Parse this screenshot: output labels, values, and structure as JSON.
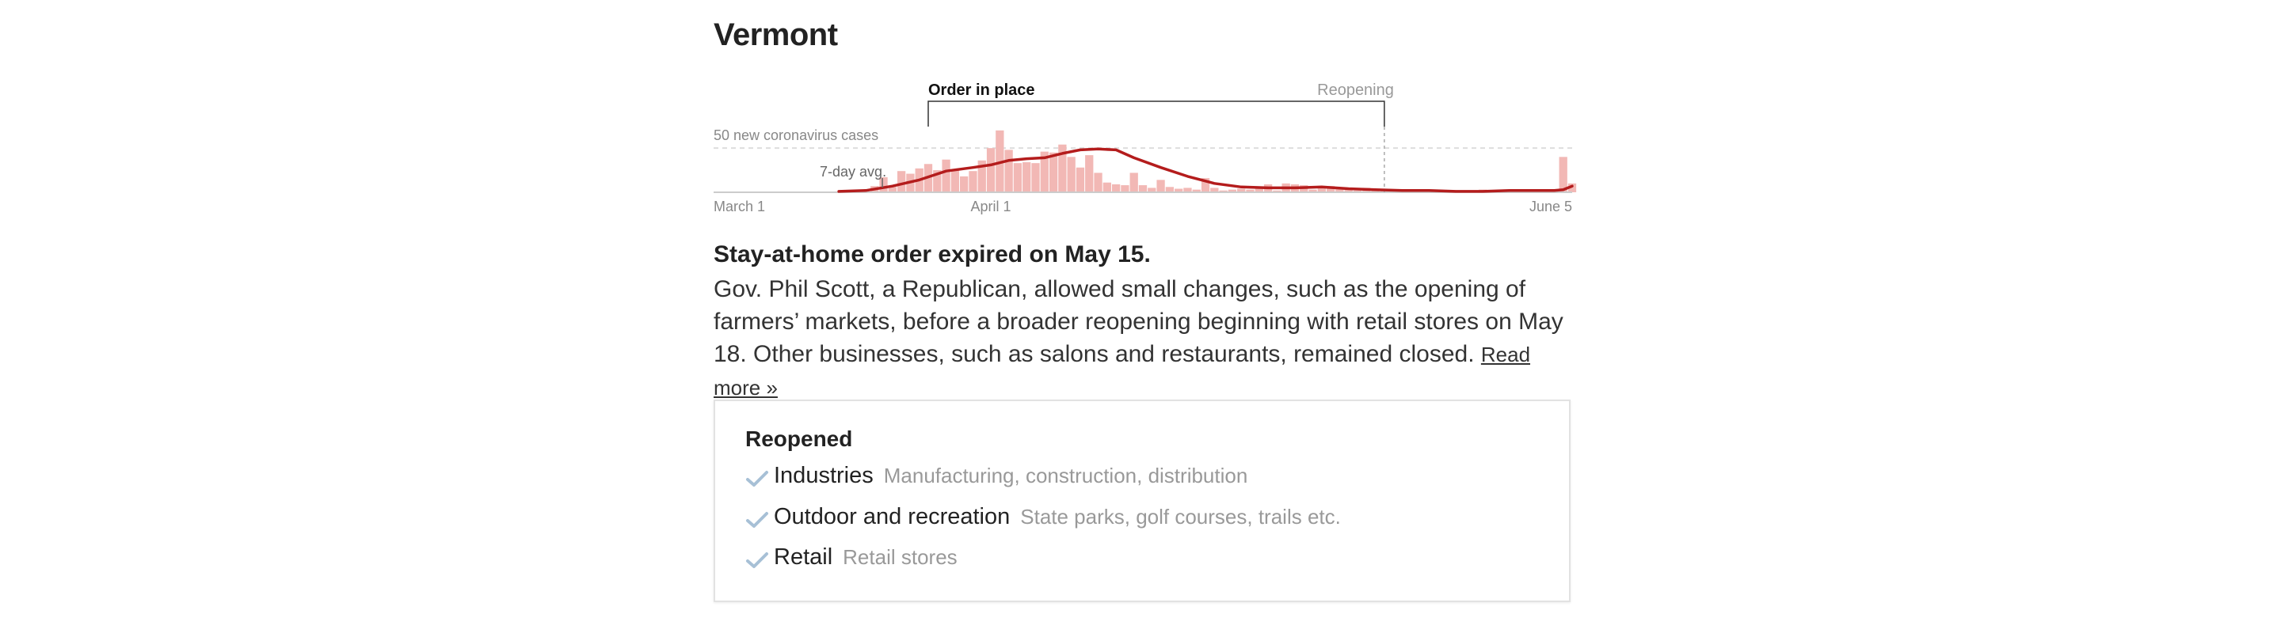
{
  "state": "Vermont",
  "chart_data": {
    "type": "bar",
    "title": "",
    "y_reference": {
      "value": 50,
      "label": "50 new coronavirus cases"
    },
    "ylim": [
      0,
      60
    ],
    "avg_label": "7-day avg.",
    "x_tick_labels": [
      "March 1",
      "April 1",
      "June 5"
    ],
    "x_start": "2020-03-01",
    "x_end": "2020-06-05",
    "periods": [
      {
        "label": "Order in place",
        "start": "2020-03-25",
        "end": "2020-05-15"
      },
      {
        "label": "Reopening",
        "start": "2020-05-15",
        "end": "2020-06-05"
      }
    ],
    "bars": [
      {
        "date": "2020-03-15",
        "cases": 1
      },
      {
        "date": "2020-03-16",
        "cases": 2
      },
      {
        "date": "2020-03-17",
        "cases": 3
      },
      {
        "date": "2020-03-18",
        "cases": 2
      },
      {
        "date": "2020-03-19",
        "cases": 7
      },
      {
        "date": "2020-03-20",
        "cases": 17
      },
      {
        "date": "2020-03-21",
        "cases": 6
      },
      {
        "date": "2020-03-22",
        "cases": 24
      },
      {
        "date": "2020-03-23",
        "cases": 21
      },
      {
        "date": "2020-03-24",
        "cases": 27
      },
      {
        "date": "2020-03-25",
        "cases": 32
      },
      {
        "date": "2020-03-26",
        "cases": 25
      },
      {
        "date": "2020-03-27",
        "cases": 37
      },
      {
        "date": "2020-03-28",
        "cases": 25
      },
      {
        "date": "2020-03-29",
        "cases": 18
      },
      {
        "date": "2020-03-30",
        "cases": 24
      },
      {
        "date": "2020-03-31",
        "cases": 36
      },
      {
        "date": "2020-04-01",
        "cases": 50
      },
      {
        "date": "2020-04-02",
        "cases": 70
      },
      {
        "date": "2020-04-03",
        "cases": 48
      },
      {
        "date": "2020-04-04",
        "cases": 33
      },
      {
        "date": "2020-04-05",
        "cases": 34
      },
      {
        "date": "2020-04-06",
        "cases": 33
      },
      {
        "date": "2020-04-07",
        "cases": 46
      },
      {
        "date": "2020-04-08",
        "cases": 45
      },
      {
        "date": "2020-04-09",
        "cases": 54
      },
      {
        "date": "2020-04-10",
        "cases": 40
      },
      {
        "date": "2020-04-11",
        "cases": 28
      },
      {
        "date": "2020-04-12",
        "cases": 42
      },
      {
        "date": "2020-04-13",
        "cases": 22
      },
      {
        "date": "2020-04-14",
        "cases": 11
      },
      {
        "date": "2020-04-15",
        "cases": 9
      },
      {
        "date": "2020-04-16",
        "cases": 8
      },
      {
        "date": "2020-04-17",
        "cases": 22
      },
      {
        "date": "2020-04-18",
        "cases": 8
      },
      {
        "date": "2020-04-19",
        "cases": 5
      },
      {
        "date": "2020-04-20",
        "cases": 14
      },
      {
        "date": "2020-04-21",
        "cases": 6
      },
      {
        "date": "2020-04-22",
        "cases": 4
      },
      {
        "date": "2020-04-23",
        "cases": 5
      },
      {
        "date": "2020-04-24",
        "cases": 3
      },
      {
        "date": "2020-04-25",
        "cases": 16
      },
      {
        "date": "2020-04-26",
        "cases": 5
      },
      {
        "date": "2020-04-27",
        "cases": 2
      },
      {
        "date": "2020-04-28",
        "cases": 3
      },
      {
        "date": "2020-04-29",
        "cases": 4
      },
      {
        "date": "2020-04-30",
        "cases": 3
      },
      {
        "date": "2020-05-01",
        "cases": 5
      },
      {
        "date": "2020-05-02",
        "cases": 9
      },
      {
        "date": "2020-05-03",
        "cases": 2
      },
      {
        "date": "2020-05-04",
        "cases": 10
      },
      {
        "date": "2020-05-05",
        "cases": 9
      },
      {
        "date": "2020-05-06",
        "cases": 8
      },
      {
        "date": "2020-05-07",
        "cases": 3
      },
      {
        "date": "2020-05-08",
        "cases": 5
      },
      {
        "date": "2020-05-09",
        "cases": 7
      },
      {
        "date": "2020-05-10",
        "cases": 4
      },
      {
        "date": "2020-05-11",
        "cases": 3
      },
      {
        "date": "2020-05-12",
        "cases": 2
      },
      {
        "date": "2020-05-13",
        "cases": 5
      },
      {
        "date": "2020-05-14",
        "cases": 3
      },
      {
        "date": "2020-05-15",
        "cases": 2
      },
      {
        "date": "2020-05-16",
        "cases": 1
      },
      {
        "date": "2020-05-17",
        "cases": 2
      },
      {
        "date": "2020-05-18",
        "cases": 3
      },
      {
        "date": "2020-05-19",
        "cases": 2
      },
      {
        "date": "2020-05-20",
        "cases": 1
      },
      {
        "date": "2020-05-21",
        "cases": 2
      },
      {
        "date": "2020-05-22",
        "cases": 1
      },
      {
        "date": "2020-05-23",
        "cases": 1
      },
      {
        "date": "2020-05-24",
        "cases": 2
      },
      {
        "date": "2020-05-25",
        "cases": 1
      },
      {
        "date": "2020-05-26",
        "cases": 3
      },
      {
        "date": "2020-05-27",
        "cases": 2
      },
      {
        "date": "2020-05-28",
        "cases": 3
      },
      {
        "date": "2020-05-29",
        "cases": 2
      },
      {
        "date": "2020-05-30",
        "cases": 3
      },
      {
        "date": "2020-05-31",
        "cases": 2
      },
      {
        "date": "2020-06-01",
        "cases": 1
      },
      {
        "date": "2020-06-02",
        "cases": 2
      },
      {
        "date": "2020-06-03",
        "cases": 3
      },
      {
        "date": "2020-06-04",
        "cases": 40
      },
      {
        "date": "2020-06-05",
        "cases": 10
      }
    ],
    "average": [
      {
        "date": "2020-03-15",
        "cases": 1
      },
      {
        "date": "2020-03-18",
        "cases": 2
      },
      {
        "date": "2020-03-21",
        "cases": 7
      },
      {
        "date": "2020-03-24",
        "cases": 14
      },
      {
        "date": "2020-03-27",
        "cases": 24
      },
      {
        "date": "2020-03-30",
        "cases": 28
      },
      {
        "date": "2020-04-01",
        "cases": 31
      },
      {
        "date": "2020-04-03",
        "cases": 36
      },
      {
        "date": "2020-04-05",
        "cases": 38
      },
      {
        "date": "2020-04-07",
        "cases": 39
      },
      {
        "date": "2020-04-09",
        "cases": 44
      },
      {
        "date": "2020-04-11",
        "cases": 48
      },
      {
        "date": "2020-04-13",
        "cases": 49
      },
      {
        "date": "2020-04-15",
        "cases": 48
      },
      {
        "date": "2020-04-17",
        "cases": 39
      },
      {
        "date": "2020-04-20",
        "cases": 28
      },
      {
        "date": "2020-04-23",
        "cases": 18
      },
      {
        "date": "2020-04-26",
        "cases": 10
      },
      {
        "date": "2020-04-29",
        "cases": 6
      },
      {
        "date": "2020-05-02",
        "cases": 5
      },
      {
        "date": "2020-05-05",
        "cases": 5
      },
      {
        "date": "2020-05-08",
        "cases": 6
      },
      {
        "date": "2020-05-11",
        "cases": 4
      },
      {
        "date": "2020-05-14",
        "cases": 3
      },
      {
        "date": "2020-05-17",
        "cases": 2
      },
      {
        "date": "2020-05-20",
        "cases": 2
      },
      {
        "date": "2020-05-23",
        "cases": 1
      },
      {
        "date": "2020-05-26",
        "cases": 1
      },
      {
        "date": "2020-05-29",
        "cases": 2
      },
      {
        "date": "2020-06-01",
        "cases": 2
      },
      {
        "date": "2020-06-03",
        "cases": 2
      },
      {
        "date": "2020-06-04",
        "cases": 3
      },
      {
        "date": "2020-06-05",
        "cases": 7
      }
    ],
    "colors": {
      "bars": "#f2b8b5",
      "average_line": "#b41c1c",
      "reference_line": "#dddddd",
      "axis": "#cccccc"
    },
    "grid": false
  },
  "headline": "Stay-at-home order expired on May 15.",
  "body": "Gov. Phil Scott, a Republican, allowed small changes, such as the opening of farmers’ markets, before a broader reopening beginning with retail stores on May 18. Other businesses, such as salons and restaurants, remained closed.",
  "read_more": "Read more »",
  "reopened": {
    "title": "Reopened",
    "icon": "check-icon",
    "icon_color": "#a7c0d6",
    "items": [
      {
        "name": "Industries",
        "detail": "Manufacturing, construction, distribution"
      },
      {
        "name": "Outdoor and recreation",
        "detail": "State parks, golf courses, trails etc."
      },
      {
        "name": "Retail",
        "detail": "Retail stores"
      }
    ]
  }
}
